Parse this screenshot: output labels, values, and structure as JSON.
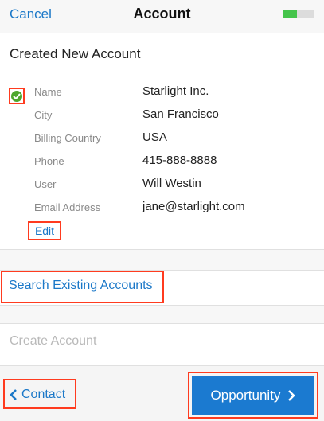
{
  "header": {
    "cancel_label": "Cancel",
    "title": "Account",
    "progress_fraction": 0.45,
    "progress_color": "#44c44b"
  },
  "section_title": "Created New Account",
  "record": {
    "fields": [
      {
        "label": "Name",
        "value": "Starlight Inc."
      },
      {
        "label": "City",
        "value": "San Francisco"
      },
      {
        "label": "Billing Country",
        "value": "USA"
      },
      {
        "label": "Phone",
        "value": "415-888-8888"
      },
      {
        "label": "User",
        "value": "Will Westin"
      },
      {
        "label": "Email Address",
        "value": "jane@starlight.com"
      }
    ],
    "edit_label": "Edit"
  },
  "actions": {
    "search_label": "Search Existing Accounts",
    "create_label": "Create Account"
  },
  "footer": {
    "back_label": "Contact",
    "next_label": "Opportunity"
  },
  "colors": {
    "accent": "#1b78c8",
    "highlight": "#ff3b1f",
    "check": "#4ea72e"
  },
  "icons": {
    "check": "check-circle-icon",
    "back": "chevron-left-icon",
    "next": "chevron-right-icon"
  }
}
